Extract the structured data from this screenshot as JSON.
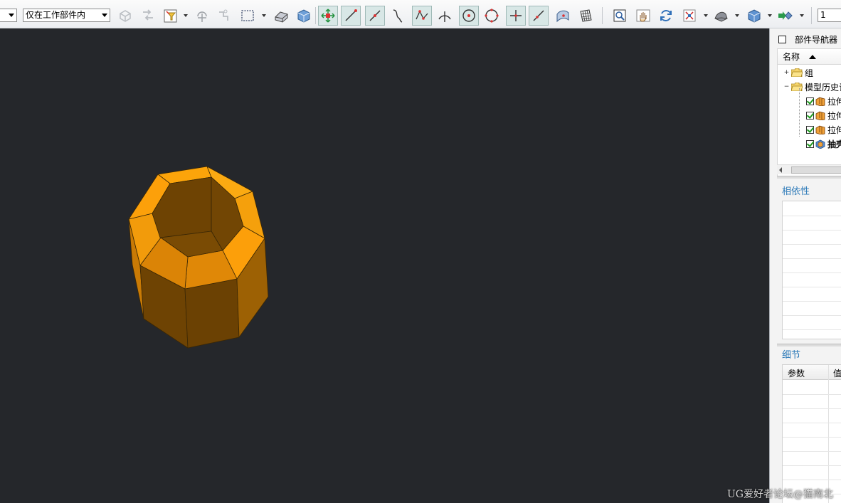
{
  "toolbar": {
    "filter_dropdown": "",
    "scope_dropdown": "仅在工作部件内",
    "layer_field": "1"
  },
  "part_navigator": {
    "title": "部件导航器",
    "column_name": "名称",
    "items": [
      {
        "label": "组",
        "expander": "+"
      },
      {
        "label": "模型历史记",
        "expander": "−"
      },
      {
        "label": "拉伸"
      },
      {
        "label": "拉伸"
      },
      {
        "label": "拉伸"
      },
      {
        "label": "抽壳"
      }
    ]
  },
  "dependencies": {
    "title": "相依性"
  },
  "details": {
    "title": "细节",
    "col_param": "参数",
    "col_value": "值"
  },
  "watermark": "UG爱好者论坛@猫南北",
  "colors": {
    "viewport_bg": "#25272b",
    "part_light": "#fca40a",
    "part_mid": "#d98306",
    "part_dark": "#6e4303"
  }
}
